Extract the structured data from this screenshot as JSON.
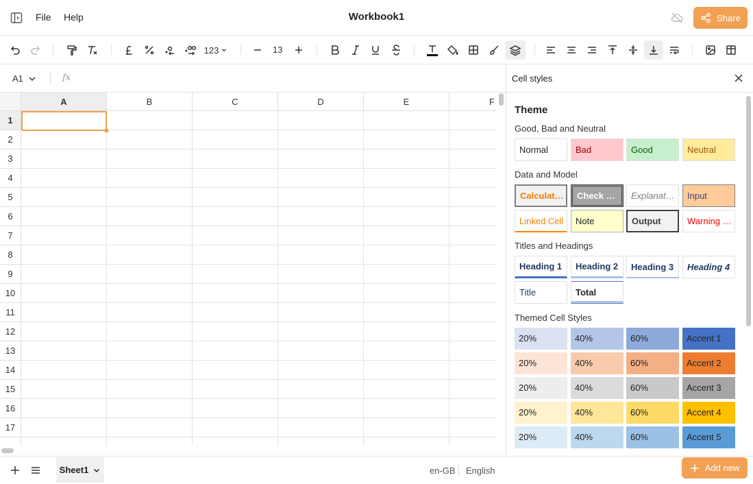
{
  "app": {
    "title": "Workbook1",
    "menu": [
      "File",
      "Help"
    ],
    "share_label": "Share"
  },
  "toolbar": {
    "number_format_label": "123",
    "font_size": "13",
    "buttons": [
      "undo",
      "redo",
      "paint-format",
      "clear-format",
      "currency-pound",
      "percent",
      "decrease-decimals",
      "increase-decimals",
      "number-format",
      "decrease-font-size",
      "font-size",
      "increase-font-size",
      "bold",
      "italic",
      "underline",
      "strikethrough",
      "text-color",
      "fill-color",
      "borders",
      "format-painter",
      "cell-styles",
      "align-left",
      "align-center",
      "align-right",
      "align-top",
      "align-middle",
      "align-bottom",
      "wrap-text",
      "insert-image",
      "insert-table"
    ]
  },
  "formula_bar": {
    "cell_ref": "A1",
    "fx_label": "fx",
    "value": ""
  },
  "grid": {
    "columns": [
      "A",
      "B",
      "C",
      "D",
      "E",
      "F"
    ],
    "rows": [
      "1",
      "2",
      "3",
      "4",
      "5",
      "6",
      "7",
      "8",
      "9",
      "10",
      "11",
      "12",
      "13",
      "14",
      "15",
      "16",
      "17"
    ],
    "selected_cell": "A1"
  },
  "bottom": {
    "sheet_name": "Sheet1",
    "locale": "en-GB",
    "language": "English"
  },
  "panel": {
    "title": "Cell styles",
    "theme_heading": "Theme",
    "sections": {
      "good_bad_neutral": "Good, Bad and Neutral",
      "data_model": "Data and Model",
      "titles_headings": "Titles and Headings",
      "themed": "Themed Cell Styles"
    },
    "good_bad_neutral": [
      "Normal",
      "Bad",
      "Good",
      "Neutral"
    ],
    "data_model": [
      "Calculation",
      "Check Cell",
      "Explanatory Text",
      "Input",
      "Linked Cell",
      "Note",
      "Output",
      "Warning Text"
    ],
    "titles_headings": [
      "Heading 1",
      "Heading 2",
      "Heading 3",
      "Heading 4",
      "Title",
      "Total"
    ],
    "themed_rows": [
      {
        "c20": "20%",
        "c40": "40%",
        "c60": "60%",
        "accent": "Accent 1"
      },
      {
        "c20": "20%",
        "c40": "40%",
        "c60": "60%",
        "accent": "Accent 2"
      },
      {
        "c20": "20%",
        "c40": "40%",
        "c60": "60%",
        "accent": "Accent 3"
      },
      {
        "c20": "20%",
        "c40": "40%",
        "c60": "60%",
        "accent": "Accent 4"
      },
      {
        "c20": "20%",
        "c40": "40%",
        "c60": "60%",
        "accent": "Accent 5"
      }
    ],
    "add_new_label": "Add new"
  },
  "colors": {
    "accent_orange": "#f2a154",
    "selection_border": "#f0a04b"
  }
}
